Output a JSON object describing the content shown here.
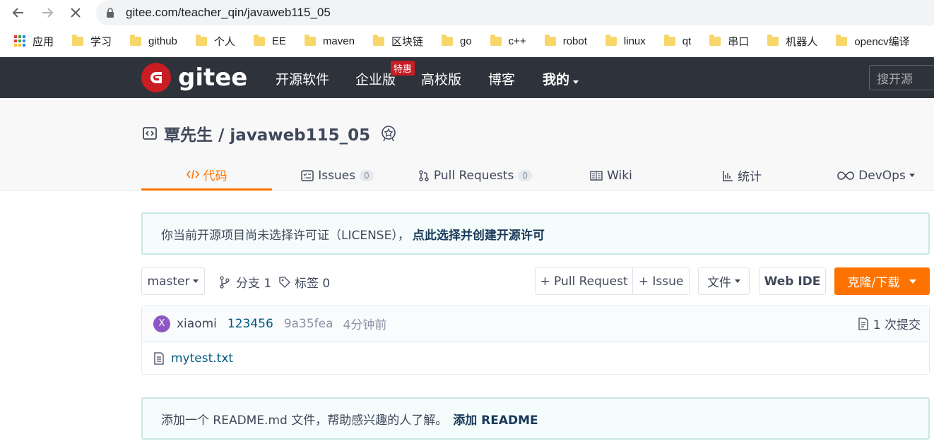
{
  "browser": {
    "url": "gitee.com/teacher_qin/javaweb115_05"
  },
  "bookmarks": {
    "apps_label": "应用",
    "items": [
      "学习",
      "github",
      "个人",
      "EE",
      "maven",
      "区块链",
      "go",
      "c++",
      "robot",
      "linux",
      "qt",
      "串口",
      "机器人",
      "opencv编译"
    ]
  },
  "header": {
    "logo_text": "gitee",
    "nav": [
      "开源软件",
      "企业版",
      "高校版",
      "博客",
      "我的"
    ],
    "hot_badge": "特惠",
    "search_placeholder": "搜开源"
  },
  "repo": {
    "owner": "覃先生",
    "name": "javaweb115_05",
    "title": "覃先生 / javaweb115_05",
    "tabs": {
      "code": "代码",
      "issues": "Issues",
      "issues_count": "0",
      "pulls": "Pull Requests",
      "pulls_count": "0",
      "wiki": "Wiki",
      "stats": "统计",
      "devops": "DevOps"
    }
  },
  "license_notice": {
    "text": "你当前开源项目尚未选择许可证（LICENSE），",
    "link": "点此选择并创建开源许可"
  },
  "toolbar": {
    "branch": "master",
    "branches_label": "分支 1",
    "tags_label": "标签 0",
    "pull_request": "+ Pull Request",
    "issue": "+ Issue",
    "files": "文件",
    "web_ide": "Web IDE",
    "clone": "克隆/下载"
  },
  "commit": {
    "avatar_letter": "X",
    "author": "xiaomi",
    "message": "123456",
    "hash": "9a35fea",
    "time": "4分钟前",
    "count_label": "1 次提交"
  },
  "files": [
    {
      "name": "mytest.txt"
    }
  ],
  "readme_notice": {
    "text": "添加一个 README.md 文件，帮助感兴趣的人了解。",
    "link": "添加 README"
  },
  "colors": {
    "accent": "#fe7300",
    "header_bg": "#2e323a",
    "logo_red": "#c71d23"
  }
}
